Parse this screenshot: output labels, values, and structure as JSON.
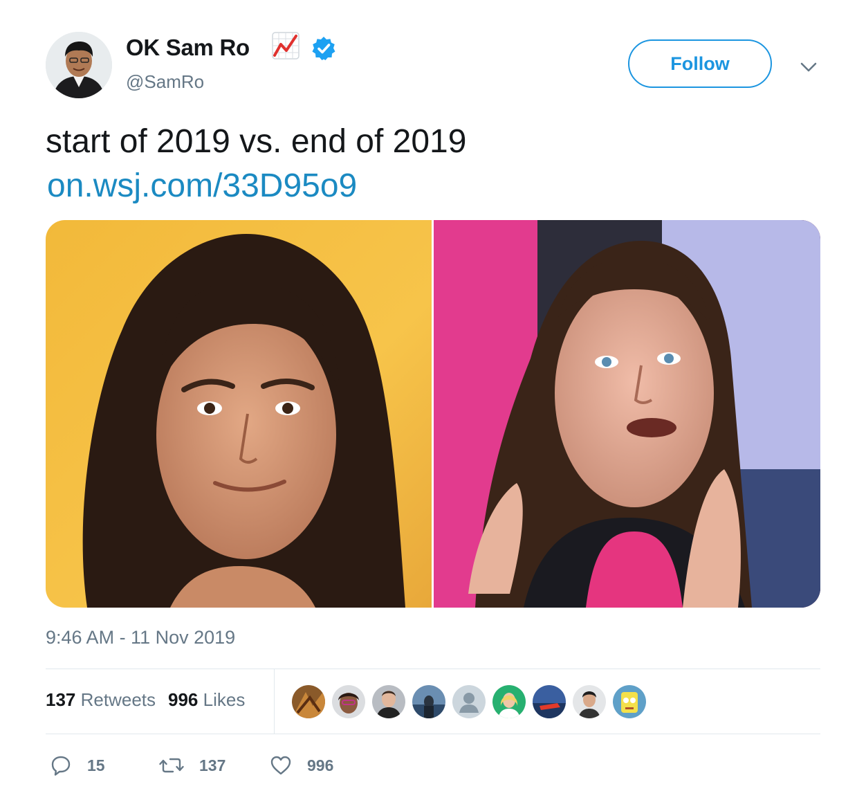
{
  "author": {
    "name": "OK Sam Ro",
    "handle": "@SamRo",
    "name_emoji_icon": "chart-increasing-icon",
    "verified_icon": "verified-badge-icon"
  },
  "follow_button": {
    "label": "Follow"
  },
  "tweet": {
    "text": "start of 2019 vs. end of 2019",
    "link": "on.wsj.com/33D95o9"
  },
  "timestamp": "9:46 AM - 11 Nov 2019",
  "stats": {
    "retweets_count": "137",
    "retweets_label": "Retweets",
    "likes_count": "996",
    "likes_label": "Likes"
  },
  "actions": {
    "reply_count": "15",
    "retweet_count": "137",
    "like_count": "996"
  },
  "colors": {
    "accent": "#1b95e0",
    "link": "#1b8ac2",
    "muted": "#657786",
    "text": "#14171a"
  }
}
